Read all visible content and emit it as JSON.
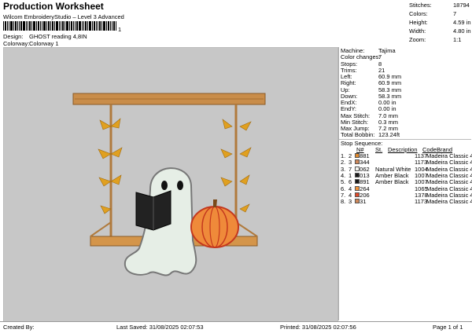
{
  "header": {
    "title": "Production Worksheet",
    "subtitle": "Wilcom EmbroideryStudio – Level 3 Advanced",
    "barcode_suffix": "1"
  },
  "design": {
    "design_label": "Design:",
    "design_value": "GHOST reading 4,8IN",
    "colorway_label": "Colorway:",
    "colorway_value": "Colorway 1"
  },
  "stats": [
    {
      "k": "Stitches:",
      "v": "18794"
    },
    {
      "k": "Colors:",
      "v": "7"
    },
    {
      "k": "Height:",
      "v": "4.59 in"
    },
    {
      "k": "Width:",
      "v": "4.80 in"
    },
    {
      "k": "Zoom:",
      "v": "1:1"
    }
  ],
  "machine": [
    {
      "k": "Machine:",
      "v": "Tajima"
    },
    {
      "k": "Color changes:",
      "v": "7"
    },
    {
      "k": "Stops:",
      "v": "8"
    },
    {
      "k": "Trims:",
      "v": "21"
    },
    {
      "k": "Left:",
      "v": "60.9 mm"
    },
    {
      "k": "Right:",
      "v": "60.9 mm"
    },
    {
      "k": "Up:",
      "v": "58.3 mm"
    },
    {
      "k": "Down:",
      "v": "58.3 mm"
    },
    {
      "k": "EndX:",
      "v": "0.00 in"
    },
    {
      "k": "EndY:",
      "v": "0.00 in"
    },
    {
      "k": "Max Stitch:",
      "v": "7.0 mm"
    },
    {
      "k": "Min Stitch:",
      "v": "0.3 mm"
    },
    {
      "k": "Max Jump:",
      "v": "7.2 mm"
    },
    {
      "k": "Total Bobbin:",
      "v": "123.24ft"
    }
  ],
  "stop_sequence": {
    "title": "Stop Sequence:",
    "headers": {
      "n": "N#",
      "st": "St.",
      "desc": "Description",
      "code": "Code",
      "brand": "Brand"
    },
    "rows": [
      {
        "idx": "1.",
        "n": "2",
        "color": "#e08a2e",
        "st": "1881",
        "desc": "",
        "code": "1137",
        "brand": "Madeira Classic 40"
      },
      {
        "idx": "2.",
        "n": "3",
        "color": "#d0895a",
        "st": "5344",
        "desc": "",
        "code": "1173",
        "brand": "Madeira Classic 40"
      },
      {
        "idx": "3.",
        "n": "7",
        "color": "#f6f6f0",
        "st": "5062",
        "desc": "Natural White",
        "code": "1004",
        "brand": "Madeira Classic 40"
      },
      {
        "idx": "4.",
        "n": "1",
        "color": "#1a1a1a",
        "st": "1013",
        "desc": "Amber Black",
        "code": "1007",
        "brand": "Madeira Classic 40"
      },
      {
        "idx": "5.",
        "n": "6",
        "color": "#1a1a1a",
        "st": "2891",
        "desc": "Amber Black",
        "code": "1007",
        "brand": "Madeira Classic 40"
      },
      {
        "idx": "6.",
        "n": "4",
        "color": "#f0923a",
        "st": "1264",
        "desc": "",
        "code": "1065",
        "brand": "Madeira Classic 40"
      },
      {
        "idx": "7.",
        "n": "4",
        "color": "#e04a2a",
        "st": "1206",
        "desc": "",
        "code": "1378",
        "brand": "Madeira Classic 40"
      },
      {
        "idx": "8.",
        "n": "3",
        "color": "#d0895a",
        "st": "131",
        "desc": "",
        "code": "1173",
        "brand": "Madeira Classic 40"
      }
    ]
  },
  "footer": {
    "created_by": "Created By:",
    "last_saved": "Last Saved: 31/08/2025 02:07:53",
    "printed": "Printed: 31/08/2025 02:07:56",
    "page": "Page 1 of 1"
  }
}
